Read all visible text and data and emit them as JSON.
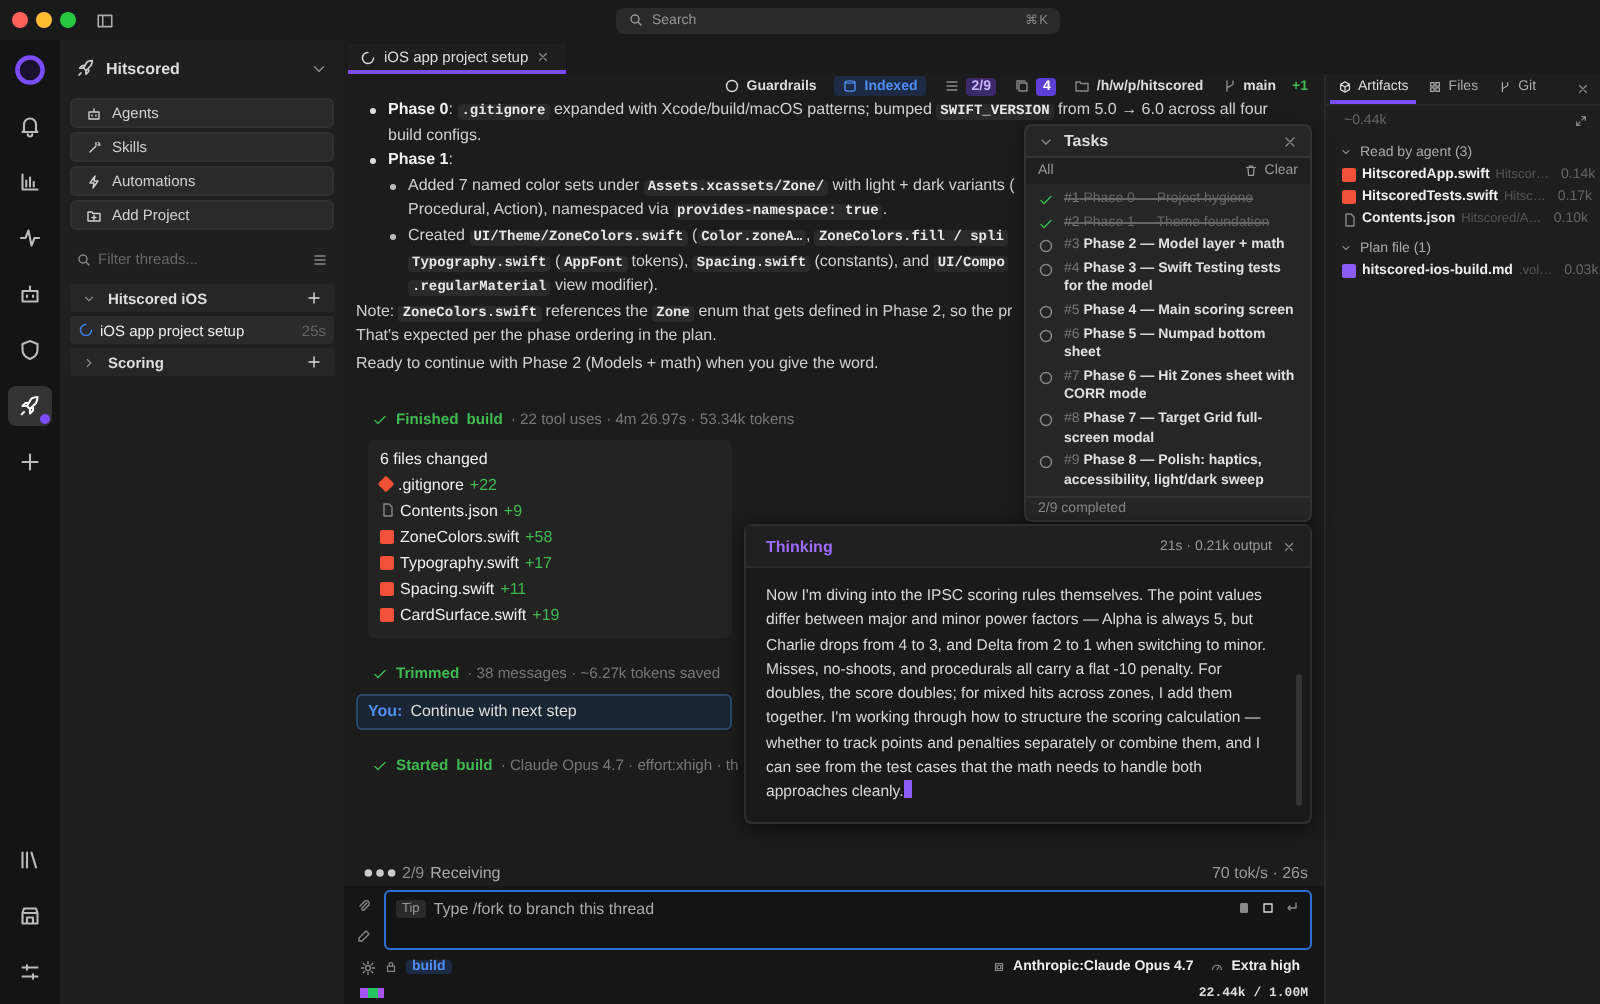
{
  "window": {
    "search_placeholder": "Search",
    "search_shortcut": "⌘K"
  },
  "rail": {
    "top": [
      {
        "kind": "bell",
        "selected": false
      },
      {
        "kind": "chart",
        "selected": false
      },
      {
        "kind": "activity",
        "selected": false
      },
      {
        "kind": "robot",
        "selected": false
      },
      {
        "kind": "shield",
        "selected": false
      },
      {
        "kind": "rocket",
        "selected": true
      },
      {
        "kind": "plus",
        "selected": false
      }
    ],
    "bottom": [
      {
        "kind": "library",
        "selected": false
      },
      {
        "kind": "store",
        "selected": false
      },
      {
        "kind": "sliders",
        "selected": false
      }
    ]
  },
  "sidebar": {
    "project": "Hitscored",
    "actions": [
      {
        "kind": "robot",
        "label": "Agents"
      },
      {
        "kind": "wand",
        "label": "Skills"
      },
      {
        "kind": "bolt",
        "label": "Automations"
      },
      {
        "kind": "folder-plus",
        "label": "Add Project"
      }
    ],
    "filter": {
      "placeholder": "Filter threads..."
    },
    "groups": [
      {
        "name": "Hitscored iOS",
        "expanded": true,
        "threads": [
          {
            "title": "iOS app project setup",
            "time": "25s",
            "selected": true,
            "running": true
          }
        ]
      },
      {
        "name": "Scoring",
        "expanded": false
      }
    ]
  },
  "tabs": [
    {
      "label": "iOS app project setup",
      "selected": true
    }
  ],
  "toolbar": {
    "guardrails": "Guardrails",
    "indexed": "Indexed",
    "tasks": "2/9",
    "copies": "4",
    "path": "/h/w/p/hitscored",
    "branch": "main",
    "ahead": "+1"
  },
  "message": {
    "blocks": [
      {
        "kind": "bullet",
        "lines": [
          [
            {
              "kind": "bold",
              "text": "Phase 0"
            },
            {
              "kind": "text",
              "text": ": "
            },
            {
              "kind": "code",
              "text": ".gitignore"
            },
            {
              "kind": "text",
              "text": " expanded with Xcode/build/macOS patterns; bumped "
            },
            {
              "kind": "code",
              "text": "SWIFT_VERSION"
            },
            {
              "kind": "text",
              "text": " from 5.0 → 6.0 across all four"
            }
          ],
          [
            {
              "kind": "text",
              "text": "build configs."
            }
          ]
        ]
      },
      {
        "kind": "bullet",
        "lines": [
          [
            {
              "kind": "bold",
              "text": "Phase 1"
            },
            {
              "kind": "text",
              "text": ":"
            }
          ]
        ],
        "children": [
          {
            "kind": "bullet",
            "lines": [
              [
                {
                  "kind": "text",
                  "text": "Added 7 named color sets under "
                },
                {
                  "kind": "code",
                  "text": "Assets.xcassets/Zone/"
                },
                {
                  "kind": "text",
                  "text": " with light + dark variants ("
                }
              ],
              [
                {
                  "kind": "text",
                  "text": "Procedural, Action), namespaced via "
                },
                {
                  "kind": "code",
                  "text": "provides-namespace: true"
                },
                {
                  "kind": "text",
                  "text": "."
                }
              ]
            ]
          },
          {
            "kind": "bullet",
            "lines": [
              [
                {
                  "kind": "text",
                  "text": "Created "
                },
                {
                  "kind": "code",
                  "text": "UI/Theme/ZoneColors.swift"
                },
                {
                  "kind": "text",
                  "text": " ("
                },
                {
                  "kind": "code",
                  "text": "Color.zoneA…"
                },
                {
                  "kind": "text",
                  "text": ", "
                },
                {
                  "kind": "code",
                  "text": "ZoneColors.fill / spli"
                }
              ],
              [
                {
                  "kind": "code",
                  "text": "Typography.swift"
                },
                {
                  "kind": "text",
                  "text": " ("
                },
                {
                  "kind": "code",
                  "text": "AppFont"
                },
                {
                  "kind": "text",
                  "text": " tokens), "
                },
                {
                  "kind": "code",
                  "text": "Spacing.swift"
                },
                {
                  "kind": "text",
                  "text": " (constants), and "
                },
                {
                  "kind": "code",
                  "text": "UI/Compo"
                }
              ],
              [
                {
                  "kind": "code",
                  "text": ".regularMaterial"
                },
                {
                  "kind": "text",
                  "text": " view modifier)."
                }
              ]
            ]
          }
        ]
      },
      {
        "kind": "paragraph",
        "lines": [
          [
            {
              "kind": "text",
              "text": "Note: "
            },
            {
              "kind": "code",
              "text": "ZoneColors.swift"
            },
            {
              "kind": "text",
              "text": " references the "
            },
            {
              "kind": "code",
              "text": "Zone"
            },
            {
              "kind": "text",
              "text": " enum that gets defined in Phase 2, so the pr"
            }
          ],
          [
            {
              "kind": "text",
              "text": "That's expected per the phase ordering in the plan."
            }
          ]
        ]
      },
      {
        "kind": "paragraph",
        "lines": [
          [
            {
              "kind": "text",
              "text": "Ready to continue with Phase 2 (Models + math) when you give the word."
            }
          ]
        ]
      }
    ]
  },
  "events": [
    {
      "kind": "finished",
      "status": "Finished",
      "agent": "build",
      "meta": "· 22 tool uses · 4m 26.97s · 53.34k tokens"
    }
  ],
  "files_changed": {
    "title": "6 files changed",
    "files": [
      {
        "kind": "git",
        "name": ".gitignore",
        "added": "+22"
      },
      {
        "kind": "json",
        "name": "Contents.json",
        "added": "+9"
      },
      {
        "kind": "swift",
        "name": "ZoneColors.swift",
        "added": "+58"
      },
      {
        "kind": "swift",
        "name": "Typography.swift",
        "added": "+17"
      },
      {
        "kind": "swift",
        "name": "Spacing.swift",
        "added": "+11"
      },
      {
        "kind": "swift",
        "name": "CardSurface.swift",
        "added": "+19"
      }
    ]
  },
  "events_after": [
    {
      "kind": "trimmed",
      "status": "Trimmed",
      "meta": "· 38 messages · ~6.27k tokens saved"
    }
  ],
  "user_message": {
    "label": "You:",
    "text": "Continue with next step"
  },
  "events_last": [
    {
      "kind": "started",
      "status": "Started",
      "agent": "build",
      "meta": "· Claude Opus 4.7 · effort:xhigh · th"
    }
  ],
  "receiving": {
    "progress": "2/9",
    "label": "Receiving",
    "rate": "70 tok/s · 26s"
  },
  "composer": {
    "tip": "Tip",
    "placeholder": "Type /fork to branch this thread",
    "agent": "build",
    "model": "Anthropic:Claude Opus 4.7",
    "effort": "Extra high",
    "context": "22.44k / 1.00M"
  },
  "tasks": {
    "title": "Tasks",
    "filter": "All",
    "clear": "Clear",
    "items": [
      {
        "number": "#1",
        "title": "Phase 0 — Project hygiene",
        "done": true
      },
      {
        "number": "#2",
        "title": "Phase 1 — Theme foundation",
        "done": true
      },
      {
        "number": "#3",
        "title": "Phase 2 — Model layer + math",
        "done": false
      },
      {
        "number": "#4",
        "title": "Phase 3 — Swift Testing tests for the model",
        "done": false
      },
      {
        "number": "#5",
        "title": "Phase 4 — Main scoring screen",
        "done": false
      },
      {
        "number": "#6",
        "title": "Phase 5 — Numpad bottom sheet",
        "done": false
      },
      {
        "number": "#7",
        "title": "Phase 6 — Hit Zones sheet with CORR mode",
        "done": false
      },
      {
        "number": "#8",
        "title": "Phase 7 — Target Grid full-screen modal",
        "done": false
      },
      {
        "number": "#9",
        "title": "Phase 8 — Polish: haptics, accessibility, light/dark sweep",
        "done": false
      }
    ],
    "footer": "2/9 completed"
  },
  "thinking": {
    "title": "Thinking",
    "meta": "21s · 0.21k output",
    "text": "Now I'm diving into the IPSC scoring rules themselves. The point values differ between major and minor power factors — Alpha is always 5, but Charlie drops from 4 to 3, and Delta from 2 to 1 when switching to minor. Misses, no-shoots, and procedurals all carry a flat -10 penalty. For doubles, the score doubles; for mixed hits across zones, I add them together. I'm working through how to structure the scoring calculation — whether to track points and penalties separately or combine them, and I can see from the test cases that the math needs to handle both approaches cleanly."
  },
  "artifacts": {
    "tabs": [
      {
        "kind": "artifacts",
        "label": "Artifacts",
        "selected": true
      },
      {
        "kind": "files",
        "label": "Files",
        "selected": false
      },
      {
        "kind": "git",
        "label": "Git",
        "selected": false
      }
    ],
    "size": "~0.44k",
    "groups": [
      {
        "name": "Read by agent (3)",
        "expanded": true,
        "files": [
          {
            "kind": "swift",
            "name": "HitscoredApp.swift",
            "path": "Hitscor…",
            "size": "0.14k"
          },
          {
            "kind": "swift",
            "name": "HitscoredTests.swift",
            "path": "Hitsc…",
            "size": "0.17k"
          },
          {
            "kind": "json",
            "name": "Contents.json",
            "path": "Hitscored/A…",
            "size": "0.10k"
          }
        ]
      },
      {
        "name": "Plan file (1)",
        "expanded": true,
        "files": [
          {
            "kind": "markdown",
            "name": "hitscored-ios-build.md",
            "path": ".vol…",
            "size": "0.03k"
          }
        ]
      }
    ]
  }
}
